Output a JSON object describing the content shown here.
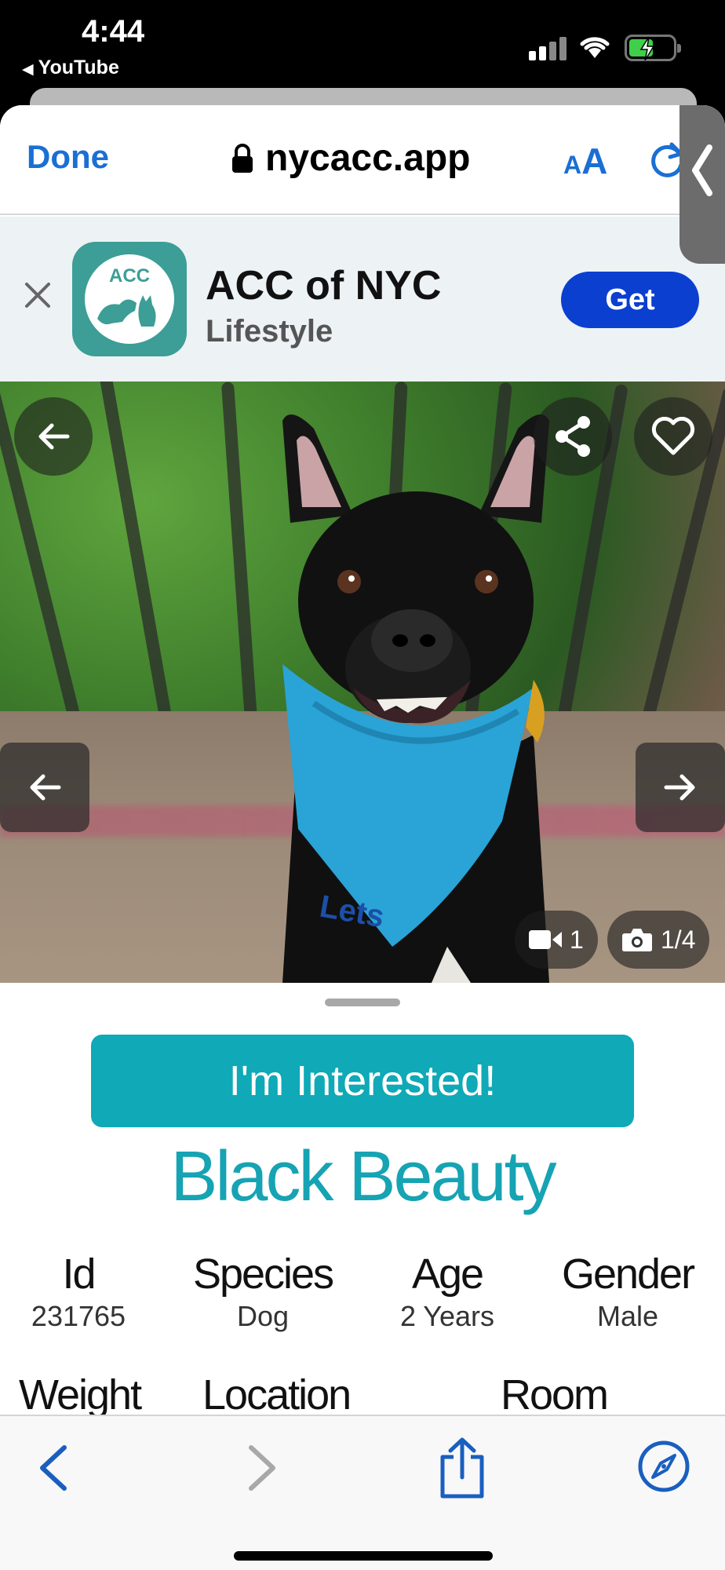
{
  "status_bar": {
    "time": "4:44",
    "back_app": "YouTube",
    "icons": [
      "signal-icon",
      "wifi-icon",
      "battery-charging-icon"
    ]
  },
  "browser": {
    "done_label": "Done",
    "url": "nycacc.app",
    "text_size_label_small": "A",
    "text_size_label_big": "A"
  },
  "app_banner": {
    "icon_text": "ACC",
    "name": "ACC of NYC",
    "category": "Lifestyle",
    "get_label": "Get"
  },
  "gallery": {
    "video_count": "1",
    "photo_counter": "1/4"
  },
  "pet": {
    "interested_label": "I'm Interested!",
    "name": "Black Beauty",
    "details": [
      {
        "label": "Id",
        "value": "231765"
      },
      {
        "label": "Species",
        "value": "Dog"
      },
      {
        "label": "Age",
        "value": "2 Years"
      },
      {
        "label": "Gender",
        "value": "Male"
      }
    ],
    "details_row2": [
      "Weight",
      "Location",
      "Room"
    ]
  },
  "colors": {
    "accent_blue": "#1a6fd3",
    "teal": "#0fa9b7",
    "get_button": "#0b3fd0"
  }
}
